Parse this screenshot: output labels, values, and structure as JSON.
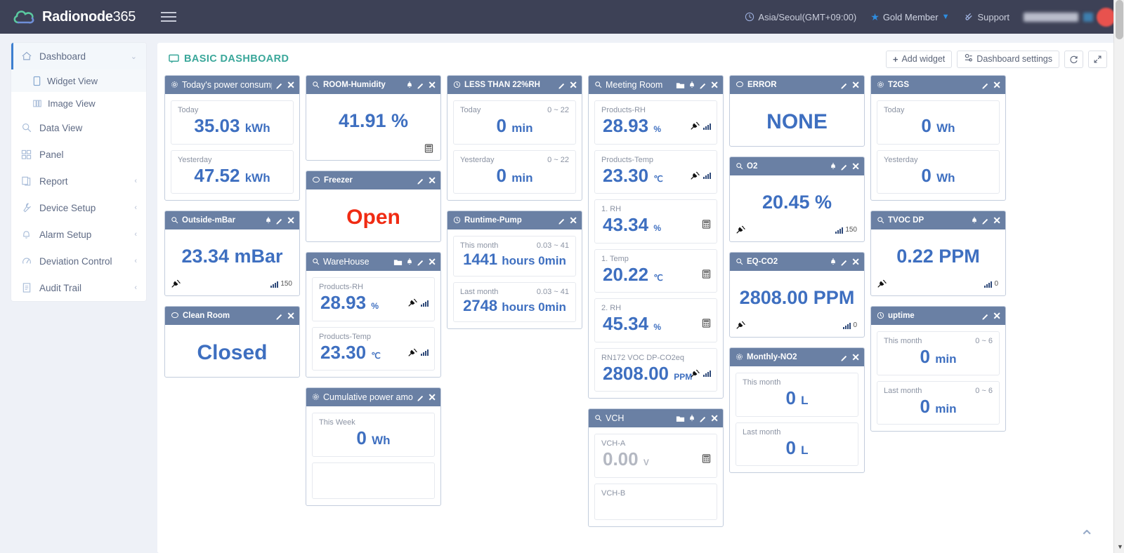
{
  "topbar": {
    "brand_main": "Radionode",
    "brand_suffix": "365",
    "timezone": "Asia/Seoul(GMT+09:00)",
    "membership": "Gold Member",
    "support": "Support",
    "icons": {
      "clock": "clock-icon",
      "star": "star-icon",
      "support": "paperclip-icon",
      "menu": "hamburger-icon"
    }
  },
  "sidebar": {
    "items": [
      {
        "label": "Dashboard",
        "icon": "home-icon",
        "state": "active",
        "arrow": "⌄"
      },
      {
        "label": "Data View",
        "icon": "search-icon",
        "state": "",
        "arrow": ""
      },
      {
        "label": "Panel",
        "icon": "grid-icon",
        "state": "",
        "arrow": ""
      },
      {
        "label": "Report",
        "icon": "report-icon",
        "state": "",
        "arrow": "‹"
      },
      {
        "label": "Device Setup",
        "icon": "wrench-icon",
        "state": "",
        "arrow": "‹"
      },
      {
        "label": "Alarm Setup",
        "icon": "bell-icon",
        "state": "",
        "arrow": "‹"
      },
      {
        "label": "Deviation Control",
        "icon": "gauge-icon",
        "state": "",
        "arrow": "‹"
      },
      {
        "label": "Audit Trail",
        "icon": "document-icon",
        "state": "",
        "arrow": "‹"
      }
    ],
    "sub_items": [
      {
        "label": "Widget View",
        "icon": "tablet-icon",
        "selected": true
      },
      {
        "label": "Image View",
        "icon": "book-icon",
        "selected": false
      }
    ]
  },
  "panel": {
    "title": "BASIC DASHBOARD",
    "title_icon": "screen-icon",
    "buttons": {
      "add_widget": "Add widget",
      "dashboard_settings": "Dashboard settings",
      "refresh": "refresh-icon",
      "expand": "expand-icon"
    },
    "accent": "#3aa79a",
    "header_bg": "#6a80a4",
    "value_color": "#3e6fc0",
    "alert_color": "#f02b13"
  },
  "columns": [
    {
      "widgets": [
        {
          "title": "Today's power consumption",
          "icon": "gear-icon",
          "title_size": "big",
          "actions": [
            "pencil-icon",
            "close-icon"
          ],
          "type": "tiles",
          "tiles": [
            {
              "label": "Today",
              "range": "",
              "value": "35.03",
              "unit": "kWh",
              "layout": "center"
            },
            {
              "label": "Yesterday",
              "range": "",
              "value": "47.52",
              "unit": "kWh",
              "layout": "center"
            }
          ]
        },
        {
          "title": "Outside-mBar",
          "icon": "search-icon",
          "title_size": "small",
          "actions": [
            "bell-icon",
            "pencil-icon",
            "close-icon"
          ],
          "type": "single",
          "value": "23.34",
          "unit": "mBar",
          "plug": true,
          "rssi": "150"
        },
        {
          "title": "Clean Room",
          "icon": "speech-icon",
          "title_size": "small",
          "actions": [
            "pencil-icon",
            "close-icon"
          ],
          "type": "text",
          "value": "Closed",
          "state_color": "blue"
        }
      ]
    },
    {
      "widgets": [
        {
          "title": "ROOM-Humidity",
          "icon": "search-icon",
          "title_size": "small",
          "actions": [
            "bell-icon",
            "pencil-icon",
            "close-icon"
          ],
          "type": "single",
          "value": "41.91",
          "unit": "%",
          "plug": false,
          "calc": true
        },
        {
          "title": "Freezer",
          "icon": "speech-icon",
          "title_size": "small",
          "actions": [
            "pencil-icon",
            "close-icon"
          ],
          "type": "text",
          "value": "Open",
          "state_color": "red"
        },
        {
          "title": "WareHouse",
          "icon": "search-icon",
          "title_size": "big",
          "actions": [
            "folder-icon",
            "bell-icon",
            "pencil-icon",
            "close-icon"
          ],
          "type": "tiles",
          "tiles": [
            {
              "label": "Products-RH",
              "range": "",
              "value": "28.93",
              "unit": "%",
              "layout": "left",
              "plug": true,
              "bars": true
            },
            {
              "label": "Products-Temp",
              "range": "",
              "value": "23.30",
              "unit": "℃",
              "layout": "left",
              "plug": true,
              "bars": true
            }
          ]
        },
        {
          "title": "Cumulative power amount",
          "icon": "gear-icon",
          "title_size": "big",
          "actions": [
            "pencil-icon",
            "close-icon"
          ],
          "type": "tiles",
          "tiles": [
            {
              "label": "This Week",
              "range": "",
              "value": "0",
              "unit": "Wh",
              "layout": "center"
            },
            {
              "label": "",
              "range": "",
              "value": "",
              "unit": "",
              "layout": "center"
            }
          ]
        }
      ]
    },
    {
      "widgets": [
        {
          "title": "LESS THAN 22%RH",
          "icon": "clock-icon",
          "title_size": "small",
          "actions": [
            "pencil-icon",
            "close-icon"
          ],
          "type": "tiles",
          "tiles": [
            {
              "label": "Today",
              "range": "0 ~ 22",
              "value": "0",
              "unit": "min",
              "layout": "center"
            },
            {
              "label": "Yesterday",
              "range": "0 ~ 22",
              "value": "0",
              "unit": "min",
              "layout": "center"
            }
          ]
        },
        {
          "title": "Runtime-Pump",
          "icon": "clock-icon",
          "title_size": "small",
          "actions": [
            "pencil-icon",
            "close-icon"
          ],
          "type": "tiles",
          "tiles": [
            {
              "label": "This month",
              "range": "0.03 ~ 41",
              "value": "1441",
              "unit": "hours 0min",
              "layout": "center",
              "size": "small"
            },
            {
              "label": "Last month",
              "range": "0.03 ~ 41",
              "value": "2748",
              "unit": "hours 0min",
              "layout": "center",
              "size": "small"
            }
          ]
        }
      ]
    },
    {
      "widgets": [
        {
          "title": "Meeting Room",
          "icon": "search-icon",
          "title_size": "big",
          "actions": [
            "folder-icon",
            "bell-icon",
            "pencil-icon",
            "close-icon"
          ],
          "type": "tiles",
          "tiles": [
            {
              "label": "Products-RH",
              "range": "",
              "value": "28.93",
              "unit": "%",
              "layout": "left",
              "plug": true,
              "bars": true
            },
            {
              "label": "Products-Temp",
              "range": "",
              "value": "23.30",
              "unit": "℃",
              "layout": "left",
              "plug": true,
              "bars": true
            },
            {
              "label": "1. RH",
              "range": "",
              "value": "43.34",
              "unit": "%",
              "layout": "left",
              "calc": true
            },
            {
              "label": "1. Temp",
              "range": "",
              "value": "20.22",
              "unit": "℃",
              "layout": "left",
              "calc": true
            },
            {
              "label": "2. RH",
              "range": "",
              "value": "45.34",
              "unit": "%",
              "layout": "left",
              "calc": true
            },
            {
              "label": "RN172 VOC DP-CO2eq",
              "range": "",
              "value": "2808.00",
              "unit": "PPM",
              "layout": "left",
              "plug": true,
              "bars": true
            }
          ]
        },
        {
          "title": "VCH",
          "icon": "search-icon",
          "title_size": "big",
          "actions": [
            "folder-icon",
            "bell-icon",
            "pencil-icon",
            "close-icon"
          ],
          "type": "tiles",
          "tiles": [
            {
              "label": "VCH-A",
              "range": "",
              "value": "0.00",
              "unit": "V",
              "layout": "left",
              "calc": true,
              "grey": true
            },
            {
              "label": "VCH-B",
              "range": "",
              "value": "",
              "unit": "",
              "layout": "left"
            }
          ]
        }
      ]
    },
    {
      "widgets": [
        {
          "title": "ERROR",
          "icon": "speech-icon",
          "title_size": "small",
          "actions": [
            "pencil-icon",
            "close-icon"
          ],
          "type": "text",
          "value": "NONE",
          "state_color": "blue"
        },
        {
          "title": "O2",
          "icon": "search-icon",
          "title_size": "small",
          "actions": [
            "bell-icon",
            "pencil-icon",
            "close-icon"
          ],
          "type": "single",
          "value": "20.45",
          "unit": "%",
          "plug": true,
          "rssi": "150"
        },
        {
          "title": "EQ-CO2",
          "icon": "search-icon",
          "title_size": "small",
          "actions": [
            "bell-icon",
            "pencil-icon",
            "close-icon"
          ],
          "type": "single",
          "value": "2808.00",
          "unit": "PPM",
          "plug": true,
          "rssi": "0"
        },
        {
          "title": "Monthly-NO2",
          "icon": "gear-icon",
          "title_size": "small",
          "actions": [
            "pencil-icon",
            "close-icon"
          ],
          "type": "tiles",
          "tiles": [
            {
              "label": "This month",
              "range": "",
              "value": "0",
              "unit": "L",
              "layout": "center"
            },
            {
              "label": "Last month",
              "range": "",
              "value": "0",
              "unit": "L",
              "layout": "center"
            }
          ]
        }
      ]
    },
    {
      "widgets": [
        {
          "title": "T2GS",
          "icon": "gear-icon",
          "title_size": "small",
          "actions": [
            "pencil-icon",
            "close-icon"
          ],
          "type": "tiles",
          "tiles": [
            {
              "label": "Today",
              "range": "",
              "value": "0",
              "unit": "Wh",
              "layout": "center"
            },
            {
              "label": "Yesterday",
              "range": "",
              "value": "0",
              "unit": "Wh",
              "layout": "center"
            }
          ]
        },
        {
          "title": "TVOC DP",
          "icon": "search-icon",
          "title_size": "small",
          "actions": [
            "bell-icon",
            "pencil-icon",
            "close-icon"
          ],
          "type": "single",
          "value": "0.22",
          "unit": "PPM",
          "plug": true,
          "rssi": "0"
        },
        {
          "title": "uptime",
          "icon": "clock-icon",
          "title_size": "small",
          "actions": [
            "pencil-icon",
            "close-icon"
          ],
          "type": "tiles",
          "tiles": [
            {
              "label": "This month",
              "range": "0 ~ 6",
              "value": "0",
              "unit": "min",
              "layout": "center"
            },
            {
              "label": "Last month",
              "range": "0 ~ 6",
              "value": "0",
              "unit": "min",
              "layout": "center"
            }
          ]
        }
      ]
    }
  ]
}
